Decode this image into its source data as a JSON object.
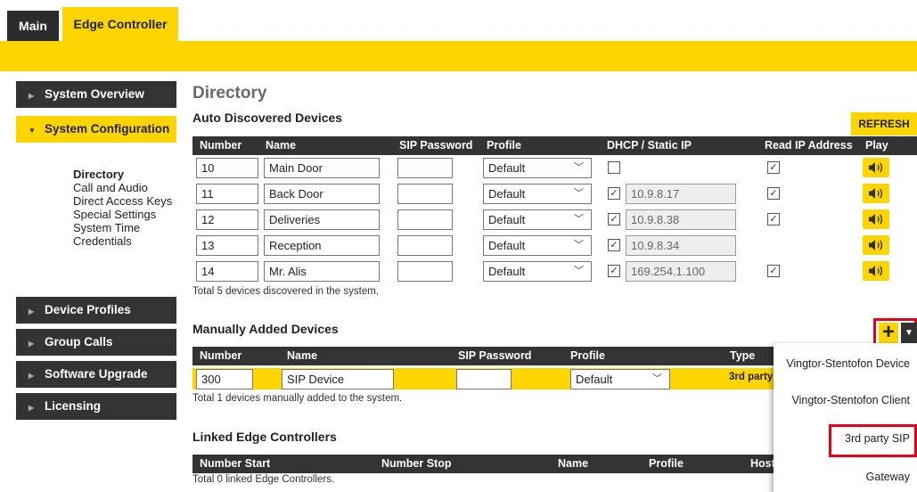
{
  "tabs": [
    {
      "label": "Main"
    },
    {
      "label": "Edge Controller"
    }
  ],
  "sidebar": {
    "items": [
      {
        "label": "System Overview"
      },
      {
        "label": "System Configuration"
      },
      {
        "label": "Device Profiles"
      },
      {
        "label": "Group Calls"
      },
      {
        "label": "Software Upgrade"
      },
      {
        "label": "Licensing"
      }
    ],
    "subnav": [
      "Directory",
      "Call and Audio",
      "Direct Access Keys",
      "Special Settings",
      "System Time",
      "Credentials"
    ]
  },
  "page_title": "Directory",
  "refresh_label": "REFRESH",
  "auto": {
    "title": "Auto Discovered Devices",
    "headers": [
      "Number",
      "Name",
      "SIP Password",
      "Profile",
      "DHCP / Static IP",
      "Read IP Address",
      "Play Tone"
    ],
    "rows": [
      {
        "number": "10",
        "name": "Main Door",
        "password": "",
        "profile": "Default",
        "dhcp_checked": false,
        "ip": "",
        "read_ip": true
      },
      {
        "number": "11",
        "name": "Back Door",
        "password": "",
        "profile": "Default",
        "dhcp_checked": true,
        "ip": "10.9.8.17",
        "read_ip": true
      },
      {
        "number": "12",
        "name": "Deliveries",
        "password": "",
        "profile": "Default",
        "dhcp_checked": true,
        "ip": "10.9.8.38",
        "read_ip": true
      },
      {
        "number": "13",
        "name": "Reception",
        "password": "",
        "profile": "Default",
        "dhcp_checked": true,
        "ip": "10.9.8.34",
        "read_ip": false
      },
      {
        "number": "14",
        "name": "Mr. Alis",
        "password": "",
        "profile": "Default",
        "dhcp_checked": true,
        "ip": "169.254.1.100",
        "read_ip": true
      }
    ],
    "total": "Total 5 devices discovered in the system."
  },
  "manual": {
    "title": "Manually Added Devices",
    "headers": [
      "Number",
      "Name",
      "SIP Password",
      "Profile",
      "Type"
    ],
    "row": {
      "number": "300",
      "name": "SIP Device",
      "password": "",
      "profile": "Default",
      "type": "3rd party :"
    },
    "total": "Total 1 devices manually added to the system."
  },
  "linked": {
    "title": "Linked Edge Controllers",
    "headers": [
      "Number Start",
      "Number Stop",
      "Name",
      "Profile",
      "Host"
    ],
    "total": "Total 0 linked Edge Controllers."
  },
  "add_menu": {
    "items": [
      "Vingtor-Stentofon Device",
      "Vingtor-Stentofon Client",
      "3rd party SIP",
      "Gateway"
    ],
    "highlighted": "3rd party SIP"
  },
  "colors": {
    "accent": "#fdd500",
    "dark": "#333333",
    "highlight": "#e2001a"
  }
}
